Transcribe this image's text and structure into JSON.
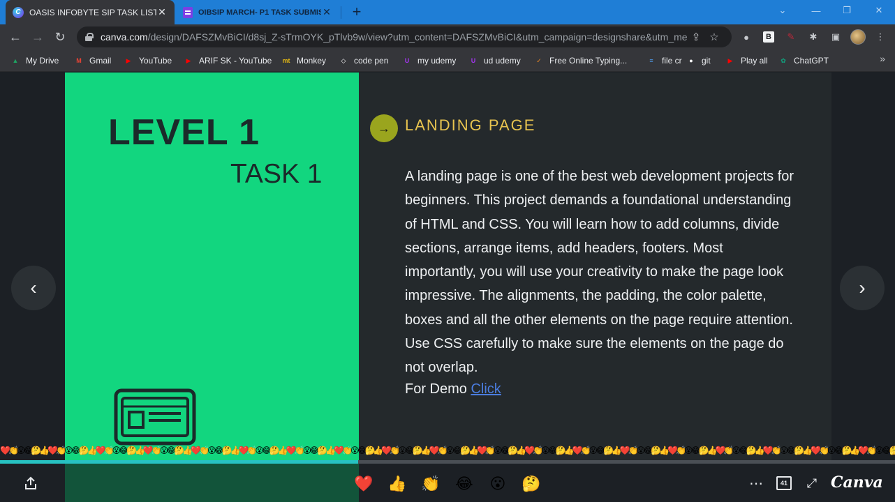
{
  "browser": {
    "tabs": [
      {
        "title": "OASIS INFOBYTE SIP TASK LIST",
        "active": true
      },
      {
        "title": "OIBSIP MARCH- P1 TASK SUBMISSION",
        "active": false
      }
    ],
    "url_host": "canva.com",
    "url_path": "/design/DAFSZMvBiCI/d8sj_Z-sTrmOYK_pTlvb9w/view?utm_content=DAFSZMvBiCI&utm_campaign=designshare&utm_me...",
    "extension_b_label": "B",
    "bookmarks": [
      {
        "label": "My Drive",
        "icon": "drive-icon",
        "color": "#1fa463"
      },
      {
        "label": "Gmail",
        "icon": "gmail-icon",
        "color": "#ea4335"
      },
      {
        "label": "YouTube",
        "icon": "youtube-icon",
        "color": "#ff0000"
      },
      {
        "label": "ARIF SK - YouTube",
        "icon": "youtube-icon",
        "color": "#ff0000"
      },
      {
        "label": "Monkey",
        "icon": "monkeytype-icon",
        "color": "#e2b714"
      },
      {
        "label": "code pen",
        "icon": "codepen-icon",
        "color": "#ffffff"
      },
      {
        "label": "my udemy",
        "icon": "udemy-icon",
        "color": "#a435f0"
      },
      {
        "label": "ud udemy",
        "icon": "udemy-icon",
        "color": "#a435f0"
      },
      {
        "label": "Free Online Typing...",
        "icon": "typing-icon",
        "color": "#f08a24"
      },
      {
        "label": "file cr",
        "icon": "filecr-icon",
        "color": "#4f9df0"
      },
      {
        "label": "git",
        "icon": "github-icon",
        "color": "#ffffff"
      },
      {
        "label": "Play all",
        "icon": "youtube-icon",
        "color": "#ff0000"
      },
      {
        "label": "ChatGPT",
        "icon": "chatgpt-icon",
        "color": "#10a37f"
      }
    ]
  },
  "slide": {
    "level": "LEVEL 1",
    "task": "TASK 1",
    "heading": "LANDING PAGE",
    "body": "A landing page is one of the best web development projects for beginners. This project demands a foundational understanding of HTML and CSS. You will learn how to add columns, divide sections, arrange items, add headers, footers. Most importantly, you will use your creativity to make the page look impressive. The alignments, the padding, the color palette, boxes and all the other elements on the page require attention. Use CSS carefully to make sure the elements on the page do not overlap.",
    "demo_label": "For Demo",
    "demo_link": "Click ",
    "colors": {
      "left_panel": "#12d67f",
      "right_panel": "#24292c",
      "heading": "#e8c44f",
      "bullet": "#9aa51e",
      "link": "#4b7de0"
    }
  },
  "viewer": {
    "progress": 0.4,
    "page_count": "41",
    "reactions": [
      "❤️",
      "👍",
      "👏",
      "😂",
      "😮",
      "🤔"
    ],
    "logo": "Canva"
  }
}
